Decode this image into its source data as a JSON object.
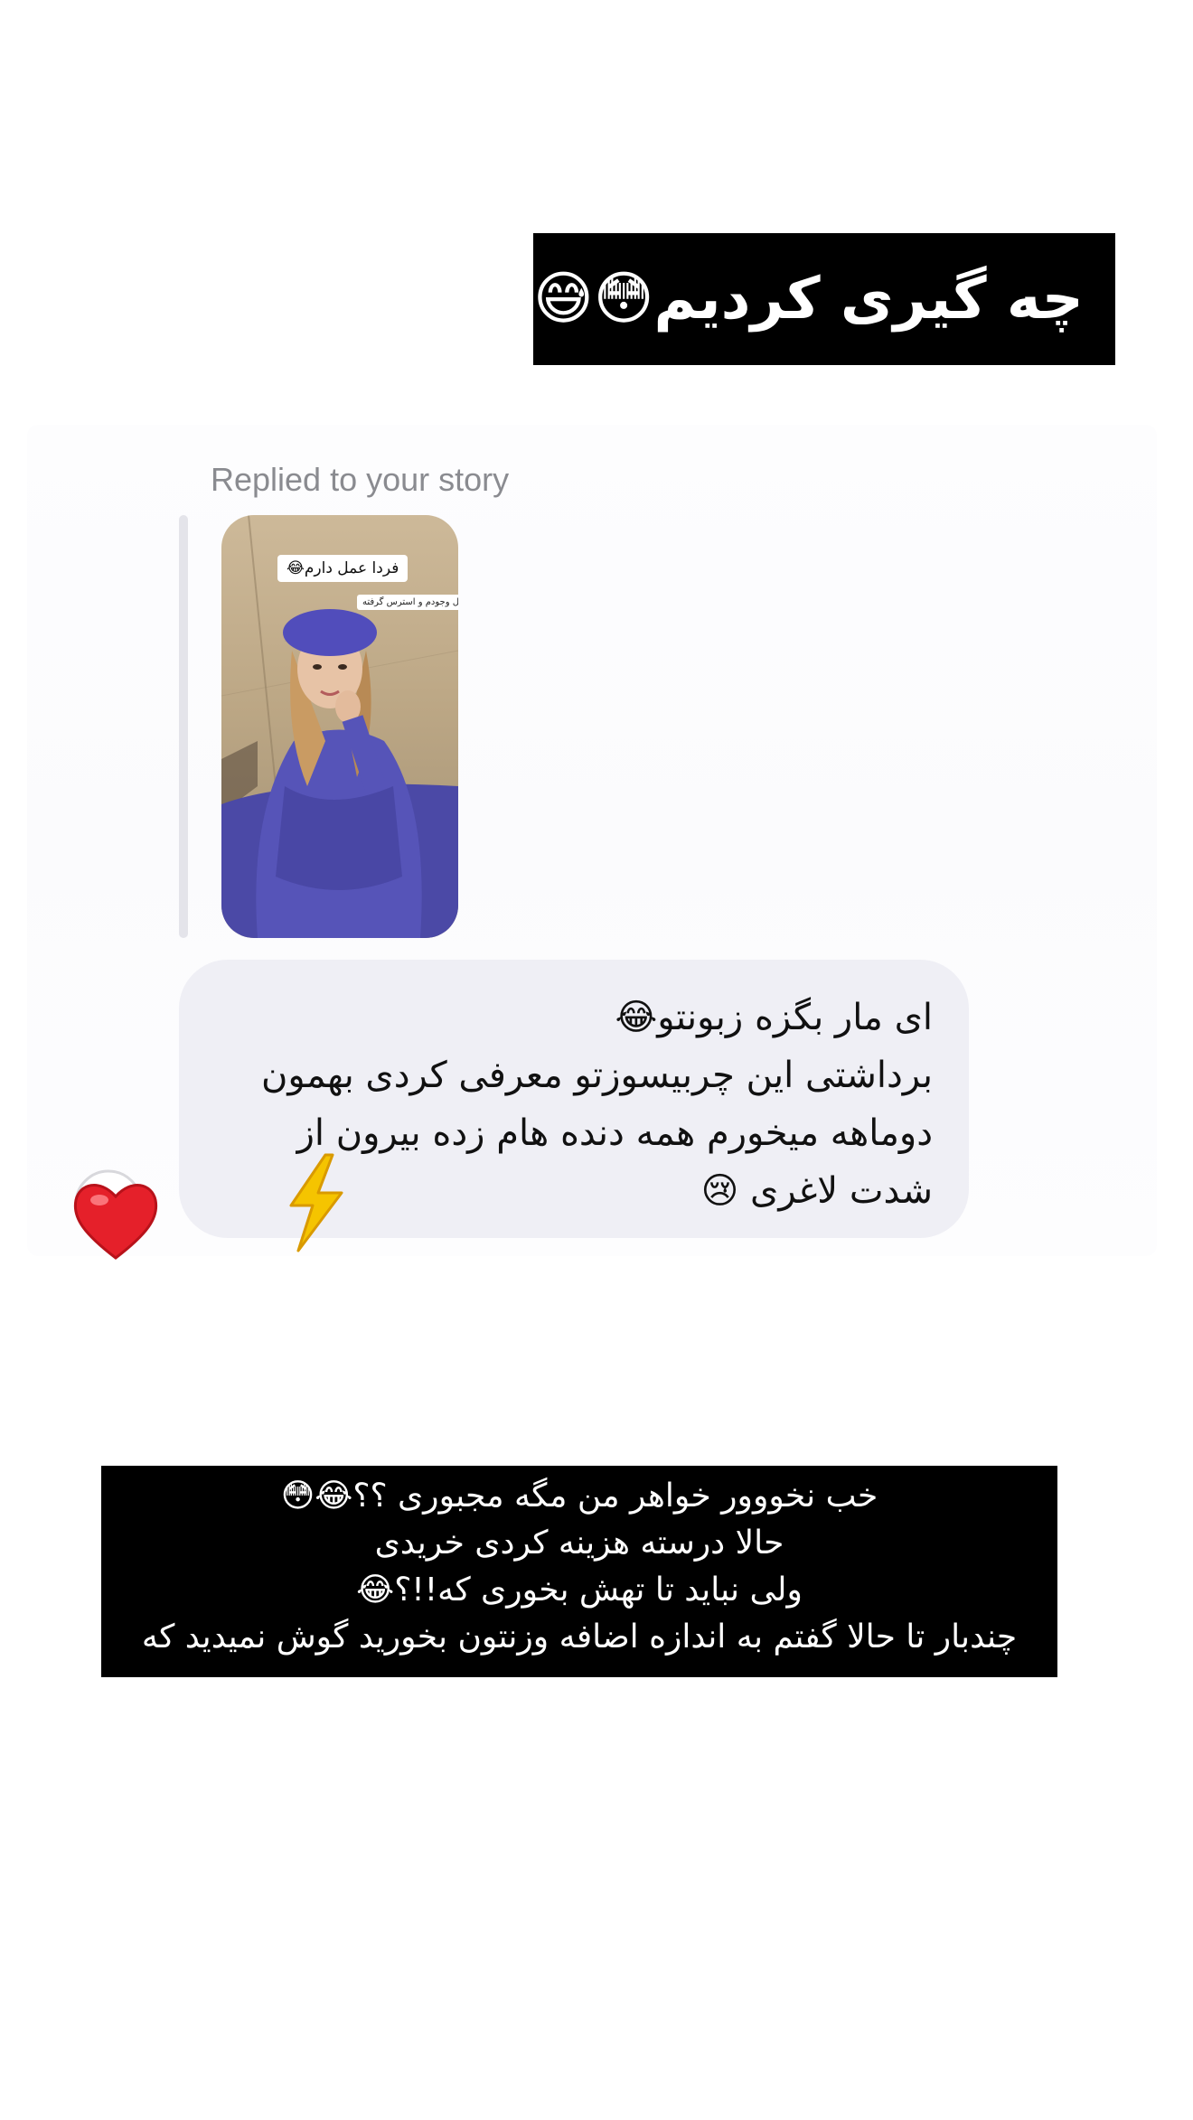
{
  "top_caption": {
    "text": "چه گیری کردیم😳😅"
  },
  "reply": {
    "header": "Replied to your story",
    "story_sticker_main": "فردا عمل دارم😂",
    "story_sticker_small": "کل وجودم و استرس گرفته"
  },
  "message": {
    "lines": [
      "ای مار بگزه زبونتو😂",
      "برداشتی این چربیسوزتو معرفی کردی بهمون",
      "دوماهه میخورم همه دنده هام زده بیرون از",
      "شدت لاغری 😢"
    ]
  },
  "reaction": {
    "icon": "heart-icon",
    "color": "#e5202a"
  },
  "bottom_caption": {
    "lines": [
      "خب نخووور خواهر من مگه مجبوری ؟؟😂😳",
      "حالا درسته هزینه کردی خریدی",
      "ولی نباید تا تهش بخوری که!!؟😂",
      "چندبار تا حالا گفتم به اندازه اضافه وزنتون بخورید گوش نمیدید که"
    ]
  },
  "colors": {
    "caption_bg": "#000000",
    "caption_text": "#ffffff",
    "bubble_bg": "#efeff5",
    "header_text": "#8a8b90",
    "bolt": "#f5c400"
  }
}
